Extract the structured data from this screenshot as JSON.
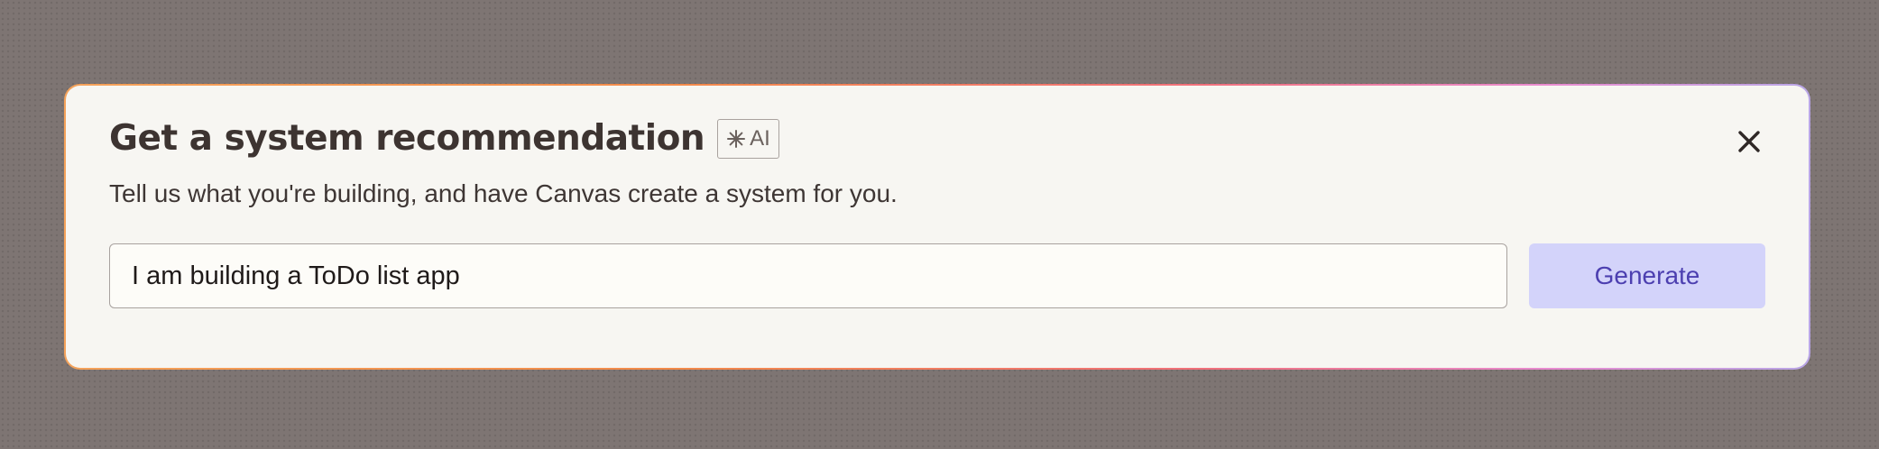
{
  "dialog": {
    "title": "Get a system recommendation",
    "ai_badge": {
      "icon": "sparkle-asterisk-icon",
      "label": "AI"
    },
    "subtitle": "Tell us what you're building, and have Canvas create a system for you.",
    "close_icon": "close-icon",
    "prompt_input": {
      "value": "I am building a ToDo list app"
    },
    "generate_label": "Generate"
  },
  "colors": {
    "page_background": "#7e7573",
    "card_background": "#f7f6f2",
    "title_text": "#3d3431",
    "generate_button_background": "#d3d3fa",
    "generate_button_text": "#4c3fb0",
    "border_gradient": [
      "#f4a25a",
      "#f0707a",
      "#e88bd0",
      "#b9a6e6"
    ]
  }
}
